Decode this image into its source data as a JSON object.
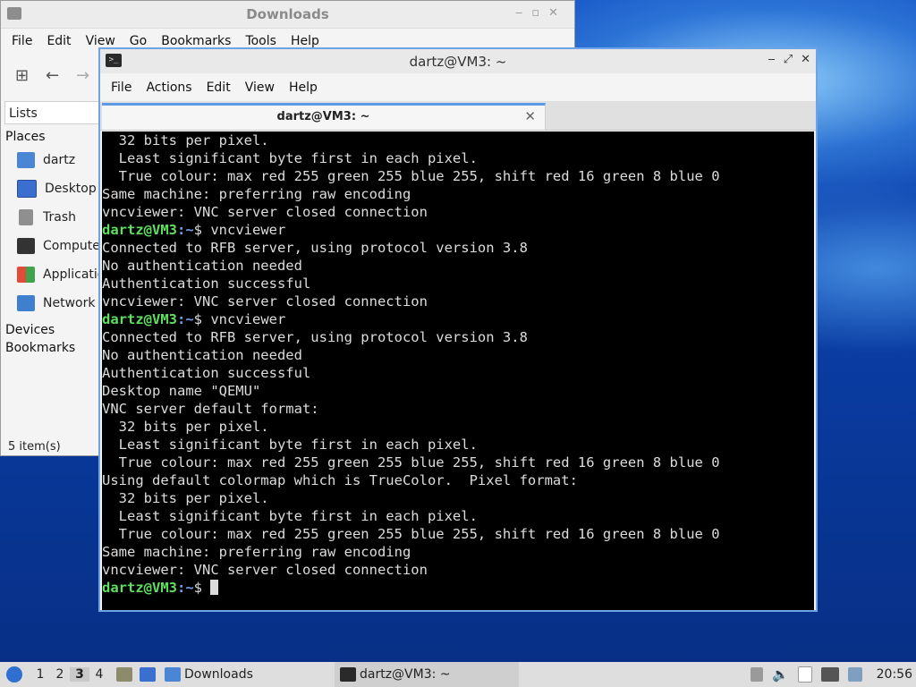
{
  "file_manager": {
    "title": "Downloads",
    "menu": [
      "File",
      "Edit",
      "View",
      "Go",
      "Bookmarks",
      "Tools",
      "Help"
    ],
    "sidebar_mode": "Lists",
    "places_header": "Places",
    "places": [
      {
        "label": "dartz",
        "icon": "home-folder-icon",
        "color": "#4a86d4"
      },
      {
        "label": "Desktop",
        "icon": "desktop-icon",
        "color": "#3a6fd0"
      },
      {
        "label": "Trash",
        "icon": "trash-icon",
        "color": "#8f8f8f"
      },
      {
        "label": "Computer",
        "icon": "computer-icon",
        "color": "#333333"
      },
      {
        "label": "Applications",
        "icon": "applications-icon",
        "color": "#e24a3a"
      },
      {
        "label": "Network",
        "icon": "network-icon",
        "color": "#3f7fd0"
      }
    ],
    "devices_header": "Devices",
    "bookmarks_header": "Bookmarks",
    "status": "5 item(s)"
  },
  "terminal": {
    "title": "dartz@VM3: ~",
    "menu": [
      "File",
      "Actions",
      "Edit",
      "View",
      "Help"
    ],
    "tab_label": "dartz@VM3: ~",
    "prompt_user": "dartz@VM3",
    "prompt_path": ":~",
    "prompt_symbol": "$",
    "lines": [
      {
        "text": "  32 bits per pixel."
      },
      {
        "text": "  Least significant byte first in each pixel."
      },
      {
        "text": "  True colour: max red 255 green 255 blue 255, shift red 16 green 8 blue 0"
      },
      {
        "text": "Same machine: preferring raw encoding"
      },
      {
        "text": "vncviewer: VNC server closed connection"
      },
      {
        "prompt": true,
        "text": " vncviewer"
      },
      {
        "text": "Connected to RFB server, using protocol version 3.8"
      },
      {
        "text": "No authentication needed"
      },
      {
        "text": "Authentication successful"
      },
      {
        "text": "vncviewer: VNC server closed connection"
      },
      {
        "prompt": true,
        "text": " vncviewer"
      },
      {
        "text": "Connected to RFB server, using protocol version 3.8"
      },
      {
        "text": "No authentication needed"
      },
      {
        "text": "Authentication successful"
      },
      {
        "text": "Desktop name \"QEMU\""
      },
      {
        "text": "VNC server default format:"
      },
      {
        "text": "  32 bits per pixel."
      },
      {
        "text": "  Least significant byte first in each pixel."
      },
      {
        "text": "  True colour: max red 255 green 255 blue 255, shift red 16 green 8 blue 0"
      },
      {
        "text": "Using default colormap which is TrueColor.  Pixel format:"
      },
      {
        "text": "  32 bits per pixel."
      },
      {
        "text": "  Least significant byte first in each pixel."
      },
      {
        "text": "  True colour: max red 255 green 255 blue 255, shift red 16 green 8 blue 0"
      },
      {
        "text": "Same machine: preferring raw encoding"
      },
      {
        "text": "vncviewer: VNC server closed connection"
      },
      {
        "prompt": true,
        "text": " ",
        "cursor": true
      }
    ]
  },
  "taskbar": {
    "workspaces": [
      "1",
      "2",
      "3",
      "4"
    ],
    "active_workspace": "3",
    "tasks": [
      {
        "label": "Downloads",
        "icon": "folder-icon"
      },
      {
        "label": "dartz@VM3: ~",
        "icon": "terminal-icon"
      }
    ],
    "clock": "20:56"
  },
  "colors": {
    "prompt_user": "#5ee05e",
    "prompt_path": "#6f9ff0",
    "terminal_bg": "#000000",
    "active_border": "#6fa3e6"
  }
}
